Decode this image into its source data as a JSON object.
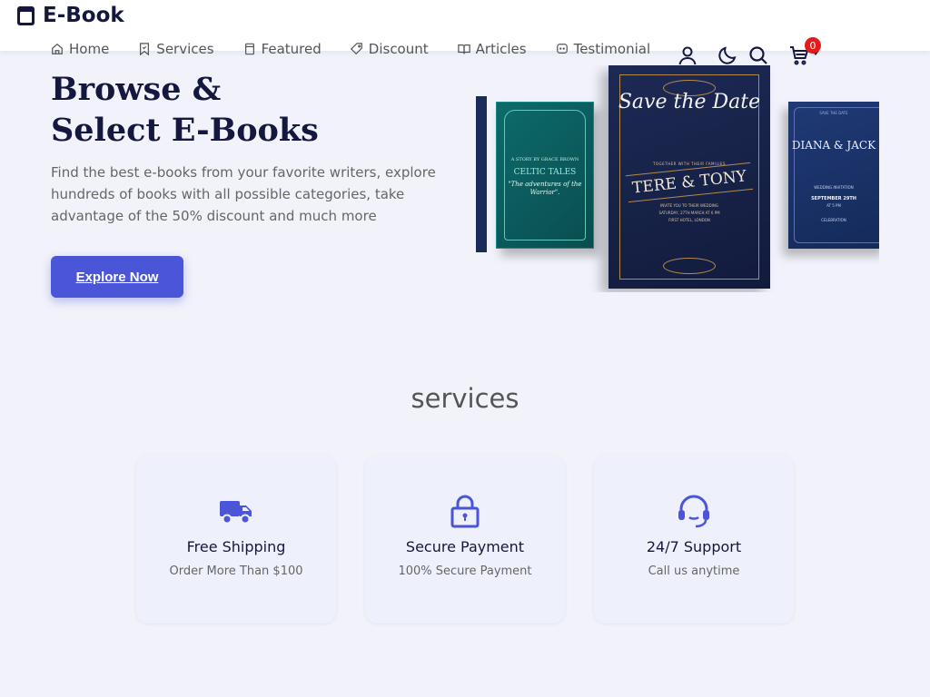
{
  "brand": {
    "name": "E-Book",
    "accent": "#4a55d8",
    "dark": "#14183e"
  },
  "nav": [
    {
      "label": "Home",
      "icon": "home-icon"
    },
    {
      "label": "Services",
      "icon": "bookmark-icon"
    },
    {
      "label": "Featured",
      "icon": "book-icon"
    },
    {
      "label": "Discount",
      "icon": "tag-icon"
    },
    {
      "label": "Articles",
      "icon": "open-book-icon"
    },
    {
      "label": "Testimonial",
      "icon": "chat-icon"
    }
  ],
  "header_icons": {
    "user": "user-icon",
    "theme": "moon-icon",
    "search": "search-icon",
    "cart": "cart-icon",
    "cart_count": "0"
  },
  "hero": {
    "title_line1": "Browse &",
    "title_line2": "Select E-Books",
    "description": "Find the best e-books from your favorite writers, explore hundreds of books with all possible categories, take advantage of the 50% discount and much more",
    "cta_label": "Explore Now"
  },
  "books": {
    "teal": {
      "author": "A STORY BY GRACE BROWN",
      "title": "CELTIC TALES",
      "subtitle": "\"The adventures of the Warrior\"."
    },
    "main": {
      "script": "Save the Date",
      "intro": "TOGETHER WITH THEIR FAMILIES",
      "names": "TERE & TONY",
      "line2": "INVITE YOU TO THEIR WEDDING",
      "date": "SATURDAY, 27TH MARCH AT 6 PM",
      "place": "FIRST HOTEL, LONDON"
    },
    "blue": {
      "top": "SAVE THE DATE",
      "names": "DIANA & JACK",
      "caption": "WEDDING INVITATION",
      "date": "SEPTEMBER 29TH",
      "time": "AT 5 PM",
      "venue": "CELEBRATION"
    }
  },
  "services": {
    "heading": "services",
    "items": [
      {
        "icon": "truck-icon",
        "title": "Free Shipping",
        "subtitle": "Order More Than $100"
      },
      {
        "icon": "lock-icon",
        "title": "Secure Payment",
        "subtitle": "100% Secure Payment"
      },
      {
        "icon": "headset-icon",
        "title": "24/7 Support",
        "subtitle": "Call us anytime"
      }
    ]
  }
}
